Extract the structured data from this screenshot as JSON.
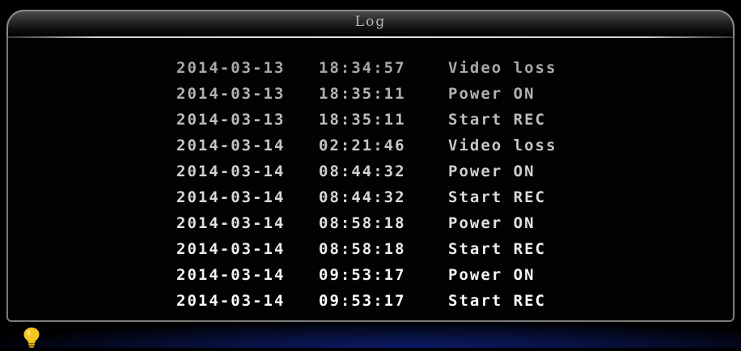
{
  "window": {
    "title": "Log"
  },
  "log": {
    "entries": [
      {
        "date": "2014-03-13",
        "time": "18:34:57",
        "event": "Video loss"
      },
      {
        "date": "2014-03-13",
        "time": "18:35:11",
        "event": "Power ON"
      },
      {
        "date": "2014-03-13",
        "time": "18:35:11",
        "event": "Start REC"
      },
      {
        "date": "2014-03-14",
        "time": "02:21:46",
        "event": "Video loss"
      },
      {
        "date": "2014-03-14",
        "time": "08:44:32",
        "event": "Power ON"
      },
      {
        "date": "2014-03-14",
        "time": "08:44:32",
        "event": "Start REC"
      },
      {
        "date": "2014-03-14",
        "time": "08:58:18",
        "event": "Power ON"
      },
      {
        "date": "2014-03-14",
        "time": "08:58:18",
        "event": "Start REC"
      },
      {
        "date": "2014-03-14",
        "time": "09:53:17",
        "event": "Power ON"
      },
      {
        "date": "2014-03-14",
        "time": "09:53:17",
        "event": "Start REC"
      }
    ],
    "row_colors": [
      "#a9a9a9",
      "#b3b3b3",
      "#bdbdbd",
      "#c6c6c6",
      "#d0d0d0",
      "#d9d9d9",
      "#e3e3e3",
      "#ececec",
      "#f4f4f4",
      "#fcfcfc"
    ]
  },
  "status": {
    "icon": "lightbulb-icon",
    "icon_color": "#f7c520"
  }
}
